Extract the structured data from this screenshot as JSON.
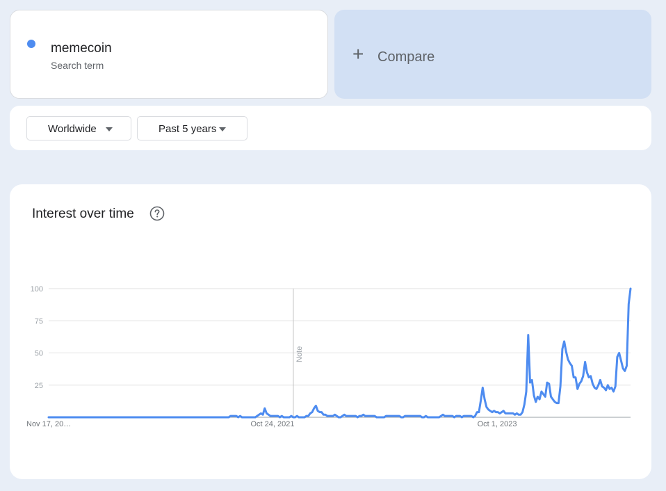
{
  "search_term": {
    "name": "memecoin",
    "subtitle": "Search term",
    "color": "#4e8cf0"
  },
  "compare": {
    "label": "Compare",
    "icon": "plus-icon"
  },
  "filters": {
    "region": "Worldwide",
    "time_range": "Past 5 years"
  },
  "chart_card": {
    "title": "Interest over time",
    "help_icon": "question-circle-icon"
  },
  "chart_data": {
    "type": "line",
    "title": "Interest over time",
    "xlabel": "",
    "ylabel": "",
    "ylim": [
      0,
      100
    ],
    "y_ticks": [
      "100",
      "75",
      "50",
      "25"
    ],
    "x_tick_labels": [
      "Nov 17, 20…",
      "Oct 24, 2021",
      "Oct 1, 2023"
    ],
    "grid": true,
    "annotation": "Note",
    "series": [
      {
        "color": "#4e8cf0",
        "values": [
          0,
          0,
          0,
          0,
          0,
          0,
          0,
          0,
          0,
          0,
          0,
          0,
          0,
          0,
          0,
          0,
          0,
          0,
          0,
          0,
          0,
          0,
          0,
          0,
          0,
          0,
          0,
          0,
          0,
          0,
          0,
          0,
          0,
          0,
          0,
          0,
          0,
          0,
          0,
          0,
          0,
          0,
          0,
          0,
          0,
          0,
          0,
          0,
          0,
          0,
          0,
          0,
          0,
          0,
          0,
          0,
          0,
          0,
          0,
          0,
          0,
          0,
          0,
          0,
          0,
          0,
          0,
          0,
          0,
          0,
          0,
          0,
          0,
          0,
          0,
          0,
          0,
          0,
          0,
          0,
          0,
          0,
          0,
          0,
          0,
          0,
          0,
          0,
          0,
          0,
          0,
          0,
          0,
          0,
          0,
          0,
          1,
          1,
          1,
          1,
          0,
          1,
          0,
          0,
          0,
          0,
          0,
          0,
          0,
          0,
          1,
          2,
          3,
          2,
          7,
          3,
          2,
          1,
          1,
          1,
          1,
          1,
          0,
          1,
          0,
          0,
          0,
          0,
          1,
          0,
          0,
          1,
          0,
          0,
          0,
          0,
          1,
          1,
          3,
          4,
          7,
          9,
          5,
          4,
          4,
          2,
          2,
          1,
          1,
          1,
          1,
          2,
          1,
          0,
          0,
          1,
          2,
          1,
          1,
          1,
          1,
          1,
          1,
          0,
          1,
          1,
          2,
          1,
          1,
          1,
          1,
          1,
          1,
          0,
          0,
          0,
          0,
          0,
          1,
          1,
          1,
          1,
          1,
          1,
          1,
          1,
          0,
          0,
          1,
          1,
          1,
          1,
          1,
          1,
          1,
          1,
          1,
          0,
          0,
          1,
          0,
          0,
          0,
          0,
          0,
          0,
          0,
          1,
          2,
          1,
          1,
          1,
          1,
          1,
          0,
          1,
          1,
          1,
          0,
          1,
          1,
          1,
          1,
          1,
          0,
          1,
          4,
          4,
          13,
          23,
          14,
          8,
          6,
          5,
          4,
          5,
          4,
          4,
          3,
          4,
          5,
          3,
          3,
          3,
          3,
          3,
          2,
          3,
          2,
          2,
          4,
          10,
          20,
          64,
          27,
          29,
          17,
          12,
          16,
          14,
          20,
          18,
          16,
          27,
          26,
          16,
          14,
          12,
          11,
          11,
          24,
          53,
          59,
          51,
          45,
          42,
          40,
          31,
          31,
          22,
          26,
          28,
          32,
          43,
          35,
          31,
          32,
          26,
          23,
          22,
          25,
          29,
          24,
          23,
          21,
          25,
          22,
          23,
          20,
          24,
          47,
          50,
          44,
          38,
          36,
          40,
          88,
          100
        ]
      }
    ]
  }
}
